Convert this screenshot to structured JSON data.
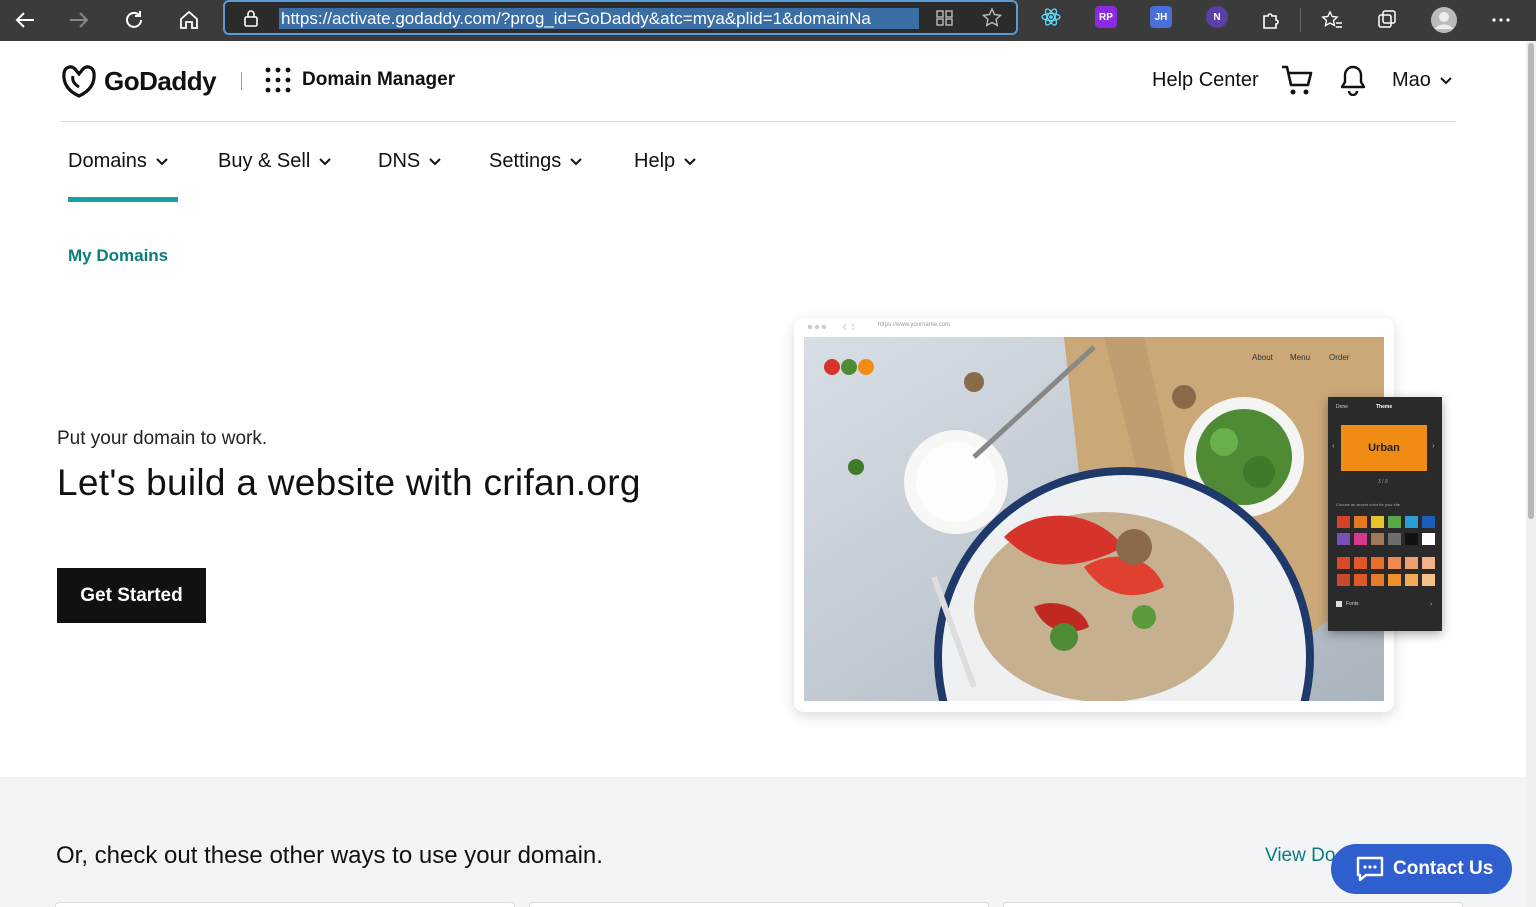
{
  "browser": {
    "url": "https://activate.godaddy.com/?prog_id=GoDaddy&atc=mya&plid=1&domainNa",
    "extensions": [
      "RP",
      "JH",
      "N"
    ]
  },
  "header": {
    "brand": "GoDaddy",
    "product": "Domain Manager",
    "help_center": "Help Center",
    "user_name": "Mao"
  },
  "nav": {
    "items": [
      {
        "label": "Domains"
      },
      {
        "label": "Buy & Sell"
      },
      {
        "label": "DNS"
      },
      {
        "label": "Settings"
      },
      {
        "label": "Help"
      }
    ]
  },
  "breadcrumb": "My Domains",
  "hero": {
    "subtitle": "Put your domain to work.",
    "title": "Let's build a website with crifan.org",
    "cta": "Get Started"
  },
  "mockup": {
    "url": "https://www.yourname.com",
    "menu": [
      "About",
      "Menu",
      "Order"
    ],
    "panel_tabs": [
      "Done",
      "Theme"
    ],
    "theme_name": "Urban",
    "theme_page": "3 / 8",
    "color_prompt": "Choose an accent color for your site",
    "fonts_label": "Fonts",
    "colors": {
      "row1": [
        "#d9412c",
        "#e67a22",
        "#e8c22a",
        "#5aa845",
        "#2a9fd6",
        "#1c5fb8"
      ],
      "row2": [
        "#7b4fb8",
        "#d63a8a",
        "#a0785a",
        "#6d6d6d",
        "#111111",
        "#ffffff"
      ],
      "row3": [
        "#d94a2a",
        "#e2572a",
        "#ea6d2c",
        "#ee8a52",
        "#f0a070",
        "#f3b08a"
      ],
      "row4": [
        "#c94a2a",
        "#dd5a28",
        "#e87b2a",
        "#f0902a",
        "#f4a85a",
        "#f6c08a"
      ]
    }
  },
  "lower": {
    "title": "Or, check out these other ways to use your domain.",
    "view_link": "View Do"
  },
  "contact": {
    "label": "Contact Us"
  },
  "colors": {
    "accent": "#1ba0a0",
    "link": "#0a7c80",
    "contact": "#2f5fcf"
  }
}
